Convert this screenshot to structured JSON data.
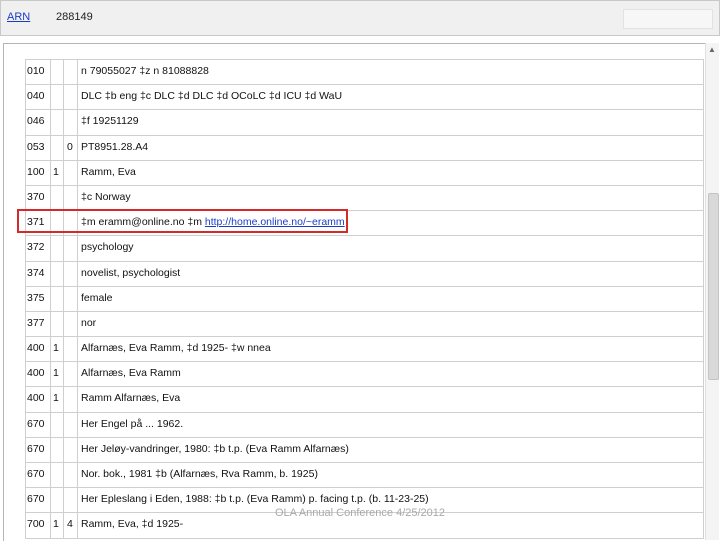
{
  "header": {
    "arn_label": "ARN",
    "arn_value": "288149"
  },
  "colors": {
    "link": "#1a3cc8",
    "highlight": "#d42a2a",
    "gridline": "#cfcfcf"
  },
  "record": {
    "fields": [
      {
        "tag": "010",
        "ind1": "",
        "ind2": "",
        "data": "n  79055027  ‡z n  81088828"
      },
      {
        "tag": "040",
        "ind1": "",
        "ind2": "",
        "data": "DLC ‡b eng ‡c DLC ‡d DLC ‡d OCoLC ‡d ICU ‡d WaU"
      },
      {
        "tag": "046",
        "ind1": "",
        "ind2": "",
        "data": "‡f 19251129"
      },
      {
        "tag": "053",
        "ind1": "",
        "ind2": "0",
        "data": "PT8951.28.A4"
      },
      {
        "tag": "100",
        "ind1": "1",
        "ind2": "",
        "data": "Ramm, Eva"
      },
      {
        "tag": "370",
        "ind1": "",
        "ind2": "",
        "data": "‡c Norway"
      },
      {
        "tag": "371",
        "ind1": "",
        "ind2": "",
        "data": "‡m eramm@online.no ‡m ",
        "url": "http://home.online.no/~eramm"
      },
      {
        "tag": "372",
        "ind1": "",
        "ind2": "",
        "data": "psychology"
      },
      {
        "tag": "374",
        "ind1": "",
        "ind2": "",
        "data": "novelist, psychologist"
      },
      {
        "tag": "375",
        "ind1": "",
        "ind2": "",
        "data": "female"
      },
      {
        "tag": "377",
        "ind1": "",
        "ind2": "",
        "data": "nor"
      },
      {
        "tag": "400",
        "ind1": "1",
        "ind2": "",
        "data": "Alfarnæs, Eva Ramm, ‡d 1925- ‡w nnea"
      },
      {
        "tag": "400",
        "ind1": "1",
        "ind2": "",
        "data": "Alfarnæs, Eva Ramm"
      },
      {
        "tag": "400",
        "ind1": "1",
        "ind2": "",
        "data": "Ramm Alfarnæs, Eva"
      },
      {
        "tag": "670",
        "ind1": "",
        "ind2": "",
        "data": "Her Engel på ... 1962."
      },
      {
        "tag": "670",
        "ind1": "",
        "ind2": "",
        "data": "Her Jeløy-vandringer, 1980: ‡b t.p. (Eva Ramm Alfarnæs)"
      },
      {
        "tag": "670",
        "ind1": "",
        "ind2": "",
        "data": "Nor. bok., 1981 ‡b (Alfarnæs, Rva Ramm, b. 1925)"
      },
      {
        "tag": "670",
        "ind1": "",
        "ind2": "",
        "data": "Her Epleslang i Eden, 1988: ‡b t.p. (Eva Ramm) p. facing t.p. (b. 11-23-25)"
      },
      {
        "tag": "700",
        "ind1": "1",
        "ind2": "4",
        "data": "Ramm, Eva, ‡d 1925-"
      }
    ]
  },
  "footer": {
    "text": "OLA Annual Conference 4/25/2012"
  }
}
